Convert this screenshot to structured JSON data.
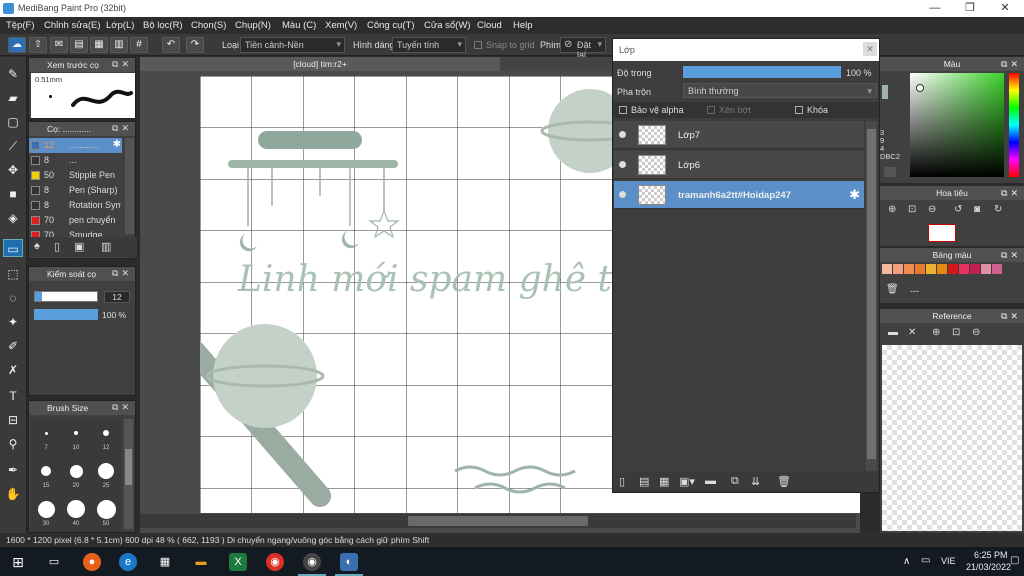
{
  "window": {
    "title": "MediBang Paint Pro (32bit)",
    "minimize": "—",
    "restore": "❐",
    "close": "✕"
  },
  "menu": [
    "Tệp(F)",
    "Chỉnh sửa(E)",
    "Lớp(L)",
    "Bộ lọc(R)",
    "Chọn(S)",
    "Chụp(N)",
    "Màu (C)",
    "Xem(V)",
    "Công cụ(T)",
    "Cửa sổ(W)",
    "Cloud",
    "Help"
  ],
  "toolbar": {
    "type_label": "Loại",
    "type_value": "Tiền cảnh-Nền",
    "shape_label": "Hình dáng",
    "shape_value": "Tuyến tính",
    "snap_label": "Snap to grid",
    "key_label": "Phím",
    "reset_label": "Đặt lại"
  },
  "brush_preview": {
    "title": "Xem trước cọ",
    "size": "0.51mm"
  },
  "brush_list": {
    "title": "Cọ: ............",
    "items": [
      {
        "size": "12",
        "name": "............",
        "color": "#3a6fb0"
      },
      {
        "size": "8",
        "name": "...",
        "color": "#333333"
      },
      {
        "size": "50",
        "name": "Stipple Pen",
        "color": "#f0d000"
      },
      {
        "size": "8",
        "name": "Pen (Sharp)",
        "color": "#333333"
      },
      {
        "size": "8",
        "name": "Rotation Sym",
        "color": "#333333"
      },
      {
        "size": "70",
        "name": "pen chuyển",
        "color": "#e02020"
      },
      {
        "size": "70",
        "name": "Smudge",
        "color": "#e02020"
      }
    ]
  },
  "brush_control": {
    "title": "Kiểm soát cọ",
    "size_value": "12",
    "opacity_value": "100 %",
    "size_fraction": 0.12,
    "opacity_fraction": 1.0
  },
  "brush_size": {
    "title": "Brush Size",
    "labels": [
      "7",
      "10",
      "12",
      "15",
      "20",
      "25",
      "30",
      "40",
      "50"
    ]
  },
  "canvas": {
    "tab_title": "[cloud] tim:r2+",
    "artwork_text": "Linh mới spam ghê th"
  },
  "layer_panel": {
    "title": "Lớp",
    "opacity_label": "Độ trong",
    "opacity_value": "100 %",
    "opacity_fraction": 1.0,
    "blend_label": "Pha trộn",
    "blend_value": "Bình thường",
    "protect_alpha": "Bảo vệ alpha",
    "clipping": "Xén bớt",
    "lock": "Khóa",
    "layers": [
      {
        "name": "Lớp7",
        "selected": false
      },
      {
        "name": "Lớp6",
        "selected": false
      },
      {
        "name": "tramanh6a2tt#Hoidap247",
        "selected": true
      }
    ]
  },
  "color_panel": {
    "title": "Màu",
    "code_lines": [
      "3",
      "9",
      "4",
      "DBC2"
    ]
  },
  "navigator": {
    "title": "Hoa tiêu"
  },
  "palette": {
    "title": "Bảng màu",
    "colors": [
      "#f4b89c",
      "#f3a07a",
      "#f08c50",
      "#e87a2e",
      "#f0b030",
      "#e88a10",
      "#d01818",
      "#e83060",
      "#c02050",
      "#e090a0",
      "#d06090"
    ],
    "dash": "---"
  },
  "reference": {
    "title": "Reference"
  },
  "status": {
    "text": "1600 * 1200 pixel   (6.8 * 5.1cm)   600 dpi   48 %   ( 662, 1193 )   Di chuyển ngang/vuông góc bằng cách giữ phím Shift"
  },
  "taskbar": {
    "lang": "VIE",
    "time": "6:25 PM",
    "date": "21/03/2022",
    "chevron": "∧"
  }
}
